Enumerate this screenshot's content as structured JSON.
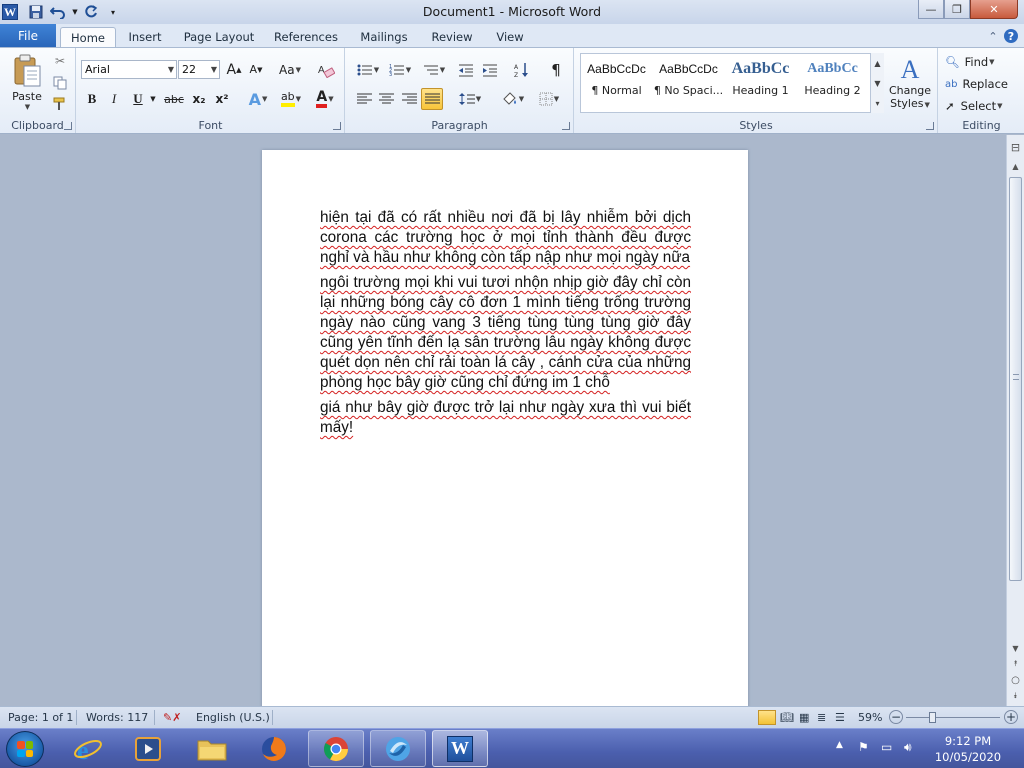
{
  "window": {
    "title": "Document1  -  Microsoft Word",
    "app_icon_letter": "W",
    "controls": {
      "minimize": "—",
      "restore": "❐",
      "close": "✕"
    }
  },
  "tabs": {
    "file": "File",
    "items": [
      "Home",
      "Insert",
      "Page Layout",
      "References",
      "Mailings",
      "Review",
      "View"
    ]
  },
  "ribbon": {
    "clipboard": {
      "label": "Clipboard",
      "paste": "Paste"
    },
    "font": {
      "label": "Font",
      "font_name": "Arial",
      "font_size": "22",
      "grow": "A",
      "shrink": "A",
      "change_case": "Aa",
      "bold": "B",
      "italic": "I",
      "underline": "U",
      "strike": "abc",
      "subscript": "x₂",
      "superscript": "x²",
      "text_effects": "A",
      "highlight": "ab",
      "font_color": "A"
    },
    "paragraph": {
      "label": "Paragraph",
      "show_marks": "¶"
    },
    "styles": {
      "label": "Styles",
      "items": [
        {
          "preview": "AaBbCcDc",
          "name": "¶ Normal"
        },
        {
          "preview": "AaBbCcDc",
          "name": "¶ No Spaci..."
        },
        {
          "preview": "AaBbCc",
          "name": "Heading 1"
        },
        {
          "preview": "AaBbCc",
          "name": "Heading 2"
        }
      ],
      "change_styles": "Change Styles",
      "change_styles_line1": "Change",
      "change_styles_line2": "Styles"
    },
    "editing": {
      "label": "Editing",
      "find": "Find",
      "replace": "Replace",
      "select": "Select"
    }
  },
  "document": {
    "paragraphs": [
      "hiện tại đã có rất nhiều nơi đã bị lây nhiễm bởi dịch corona các trường học ở mọi tỉnh thành đều được nghỉ và hầu như không còn tấp nập như mọi ngày nữa",
      "ngôi trường mọi khi vui tươi nhộn nhịp giờ đây chỉ còn lại những bóng cây cô đơn 1 mình tiếng trống trường ngày nào cũng vang 3 tiếng tùng tùng tùng giờ đây cũng yên tĩnh đến lạ sân trường lâu ngày không được quét dọn nên chỉ rải toàn lá cây , cánh cửa  của những phòng học bây giờ cũng chỉ đứng im 1 chỗ",
      "giá như bây giờ được trở lại như ngày xưa thì vui biết mấy!"
    ]
  },
  "status": {
    "page": "Page: 1 of 1",
    "words": "Words: 117",
    "language": "English (U.S.)",
    "zoom": "59%",
    "zoom_minus": "−",
    "zoom_plus": "+"
  },
  "taskbar": {
    "time": "9:12 PM",
    "date": "10/05/2020"
  },
  "colors": {
    "file_tab": "#2a66b9",
    "heading_blue": "#365f91",
    "taskbar": "#4b5fae"
  }
}
